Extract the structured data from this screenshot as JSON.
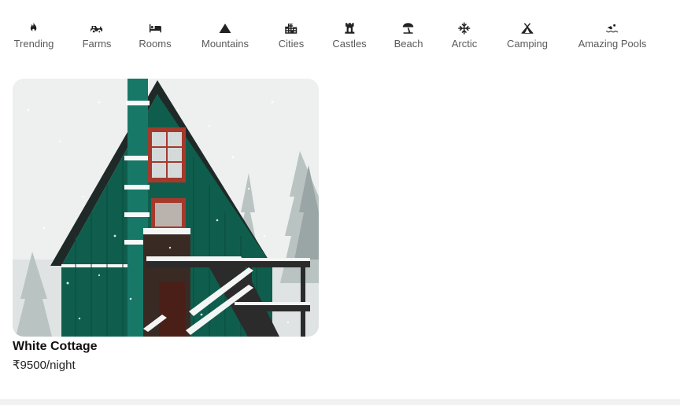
{
  "categories": [
    {
      "label": "Trending",
      "icon": "fire-icon"
    },
    {
      "label": "Farms",
      "icon": "tractor-icon"
    },
    {
      "label": "Rooms",
      "icon": "bed-icon"
    },
    {
      "label": "Mountains",
      "icon": "mountain-icon"
    },
    {
      "label": "Cities",
      "icon": "city-icon"
    },
    {
      "label": "Castles",
      "icon": "castle-icon"
    },
    {
      "label": "Beach",
      "icon": "umbrella-beach-icon"
    },
    {
      "label": "Arctic",
      "icon": "snowflake-icon"
    },
    {
      "label": "Camping",
      "icon": "tent-icon"
    },
    {
      "label": "Amazing Pools",
      "icon": "swimmer-icon"
    }
  ],
  "listing": {
    "title": "White Cottage",
    "price": "₹9500/night",
    "image": "snow-covered-green-a-frame-cabin-photo"
  },
  "colors": {
    "text": "#222222",
    "label_gray": "#5a5a5a",
    "cabin_green": "#0f5e4d",
    "window_red": "#a4392c"
  }
}
